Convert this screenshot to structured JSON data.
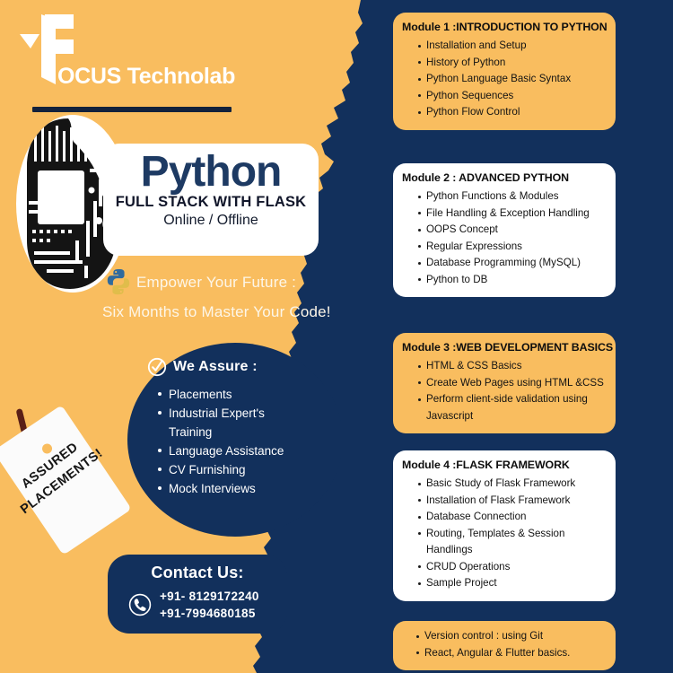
{
  "colors": {
    "orange": "#f9bd5f",
    "navy": "#12305c",
    "white": "#ffffff",
    "cream": "#fdf6e8",
    "tag_string": "#5a1f17"
  },
  "brand": {
    "logo_icon": "focus-f-logo-icon",
    "name": "OCUS Technolab",
    "full_name": "FOCUS Technolab"
  },
  "hero": {
    "head_icon": "circuit-board-head-icon",
    "title": "Python",
    "subtitle": "FULL STACK WITH FLASK",
    "mode": "Online / Offline",
    "python_icon": "python-logo-icon",
    "tagline_line1": "Empower Your Future :",
    "tagline_line2": "Six Months to Master Your Code!"
  },
  "assure": {
    "check_icon": "check-circle-icon",
    "heading": "We Assure :",
    "items": [
      "Placements",
      "Industrial Expert's",
      "Training",
      "Language Assistance",
      "CV Furnishing",
      "Mock Interviews"
    ]
  },
  "tag": {
    "line1": "ASSURED",
    "line2": "PLACEMENTS!"
  },
  "contact": {
    "title": "Contact Us:",
    "phone_icon": "phone-handset-icon",
    "phones": [
      "+91- 8129172240",
      "+91-7994680185"
    ]
  },
  "modules": [
    {
      "title": "Module 1 :INTRODUCTION TO PYTHON",
      "theme": "orange",
      "items": [
        "Installation and Setup",
        "History of Python",
        "Python Language Basic Syntax",
        "Python Sequences",
        "Python Flow Control"
      ]
    },
    {
      "title": "Module 2 : ADVANCED PYTHON",
      "theme": "white",
      "items": [
        "Python Functions & Modules",
        "File Handling & Exception Handling",
        "OOPS Concept",
        "Regular Expressions",
        "Database Programming (MySQL)",
        "Python to DB"
      ]
    },
    {
      "title": "Module 3 :WEB DEVELOPMENT BASICS",
      "theme": "orange",
      "items": [
        "HTML & CSS Basics",
        "Create Web Pages using HTML &CSS",
        "Perform client-side validation using",
        "Javascript"
      ]
    },
    {
      "title": "Module 4 :FLASK FRAMEWORK",
      "theme": "white",
      "items": [
        "Basic Study of Flask Framework",
        "Installation of Flask Framework",
        "Database Connection",
        "Routing, Templates & Session Handlings",
        "CRUD Operations",
        "Sample Project"
      ]
    },
    {
      "title": "",
      "theme": "orange",
      "items": [
        "Version control : using Git",
        "React, Angular & Flutter basics."
      ]
    }
  ]
}
